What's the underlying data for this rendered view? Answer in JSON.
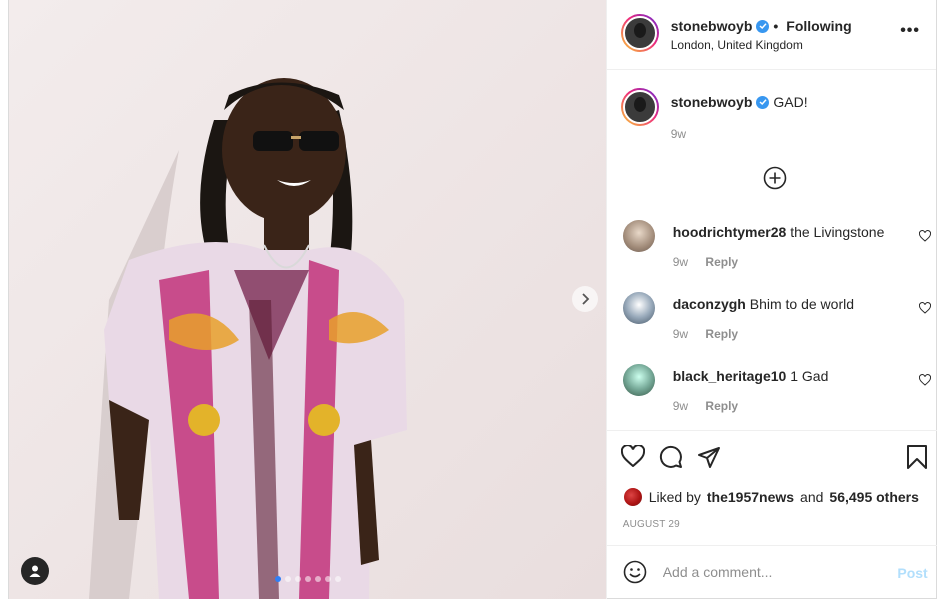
{
  "post": {
    "username": "stonebwoyb",
    "verified": true,
    "separator": "•",
    "follow_status": "Following",
    "location": "London, United Kingdom"
  },
  "caption": {
    "username": "stonebwoyb",
    "text": "GAD!",
    "age": "9w"
  },
  "comments": [
    {
      "username": "hoodrichtymer28",
      "text": "the Livingstone",
      "age": "9w",
      "reply": "Reply"
    },
    {
      "username": "daconzygh",
      "text": "Bhim to de world",
      "age": "9w",
      "reply": "Reply"
    },
    {
      "username": "black_heritage10",
      "text": "1 Gad",
      "age": "9w",
      "reply": "Reply"
    }
  ],
  "likes": {
    "prefix": "Liked by",
    "liker": "the1957news",
    "conjunction": "and",
    "others": "56,495 others"
  },
  "date": "AUGUST 29",
  "add_comment": {
    "placeholder": "Add a comment...",
    "post_label": "Post"
  },
  "carousel": {
    "slide_count": 7,
    "active_index": 0
  },
  "icons": [
    "more-options-icon",
    "verified-badge-icon",
    "load-more-comments-icon",
    "heart-icon",
    "comment-icon",
    "share-icon",
    "bookmark-icon",
    "emoji-icon",
    "next-arrow-icon",
    "tag-user-icon"
  ],
  "colors": {
    "accent": "#3897f0",
    "post_button": "#b2dffc",
    "muted": "#8e8e8e"
  }
}
